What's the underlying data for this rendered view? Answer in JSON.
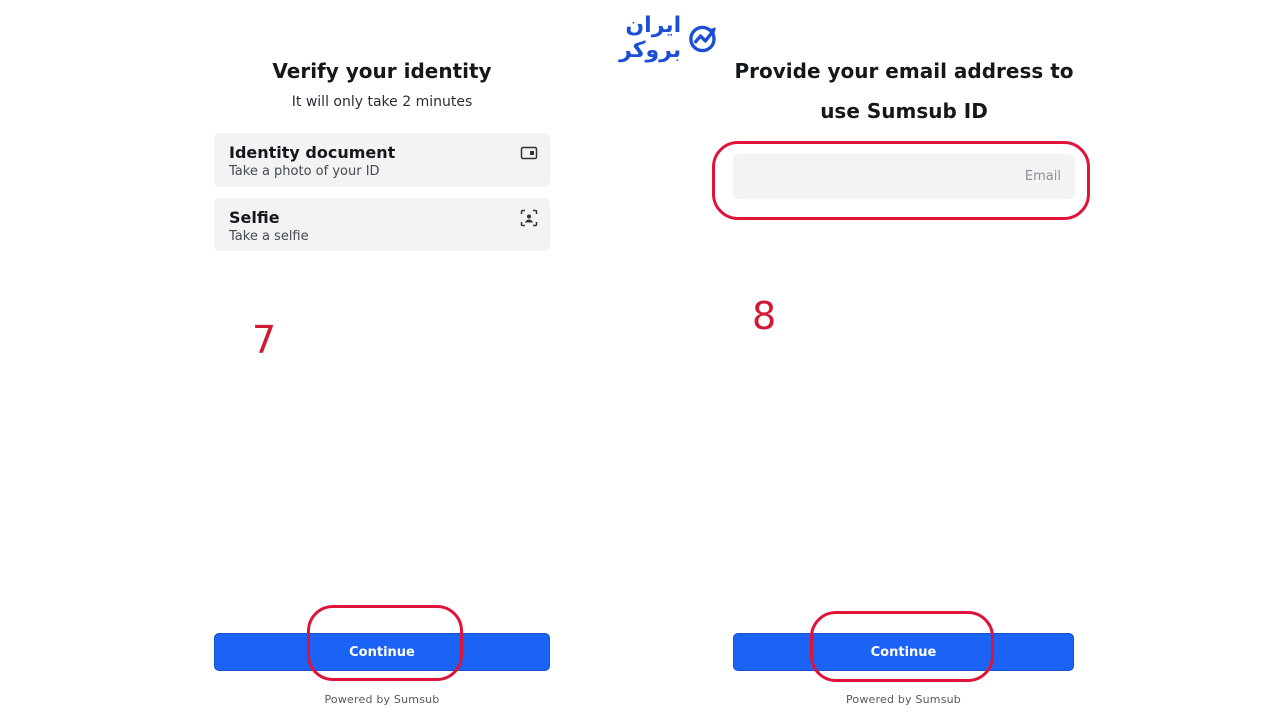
{
  "logo": {
    "text": "ایران بروکر",
    "icon": "chart-arrow-circle-icon",
    "color": "#1d4fd6"
  },
  "left_screen": {
    "title": "Verify your identity",
    "subtitle": "It will only take 2 minutes",
    "items": [
      {
        "title": "Identity document",
        "subtitle": "Take a photo of your ID",
        "icon": "id-card-icon"
      },
      {
        "title": "Selfie",
        "subtitle": "Take a selfie",
        "icon": "face-scan-icon"
      }
    ],
    "continue_label": "Continue",
    "powered_by": "Powered by Sumsub",
    "step_number": "7"
  },
  "right_screen": {
    "title_line1": "Provide your email address to",
    "title_line2": "use Sumsub ID",
    "email": {
      "value": "",
      "placeholder": "Email"
    },
    "continue_label": "Continue",
    "powered_by": "Powered by Sumsub",
    "step_number": "8"
  },
  "colors": {
    "accent": "#1b63f5",
    "annotation": "#e0143a",
    "card_bg": "#f3f3f3"
  }
}
